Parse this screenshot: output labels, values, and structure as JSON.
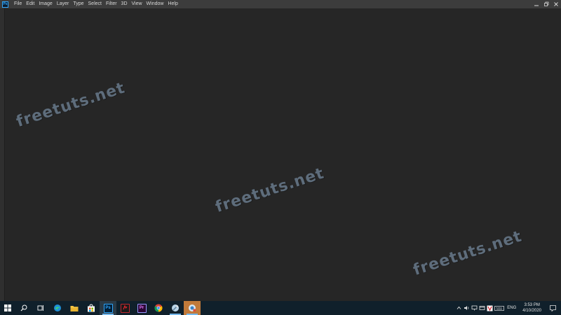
{
  "app": {
    "logo_text": "Ps"
  },
  "menu": [
    "File",
    "Edit",
    "Image",
    "Layer",
    "Type",
    "Select",
    "Filter",
    "3D",
    "View",
    "Window",
    "Help"
  ],
  "window_controls": [
    "minimize-icon",
    "restore-icon",
    "close-icon"
  ],
  "watermarks": [
    "freetuts.net",
    "freetuts.net",
    "freetuts.net"
  ],
  "taskbar": {
    "pinned": [
      {
        "name": "start",
        "icon": "windows-logo-icon"
      },
      {
        "name": "search",
        "icon": "search-icon"
      },
      {
        "name": "task-view",
        "icon": "task-view-icon"
      },
      {
        "name": "edge",
        "icon": "edge-icon"
      },
      {
        "name": "file-explorer",
        "icon": "folder-icon"
      },
      {
        "name": "store",
        "icon": "store-icon"
      },
      {
        "name": "photoshop",
        "icon": "photoshop-icon",
        "text": "Ps"
      },
      {
        "name": "app-red",
        "icon": "app-icon"
      },
      {
        "name": "premiere",
        "icon": "premiere-icon",
        "text": "Pr"
      },
      {
        "name": "chrome",
        "icon": "chrome-icon"
      },
      {
        "name": "app-brush",
        "icon": "brush-app-icon"
      },
      {
        "name": "app-orange",
        "icon": "tool-app-icon"
      }
    ],
    "tray": {
      "language": "ENG",
      "time": "3:53 PM",
      "date": "4/10/2020"
    }
  },
  "colors": {
    "menubar": "#3c3c3c",
    "workspace": "#262626",
    "taskbar": "#10202b",
    "watermark": "#5e6d7c",
    "active_app_highlight": "#c17a3a"
  }
}
